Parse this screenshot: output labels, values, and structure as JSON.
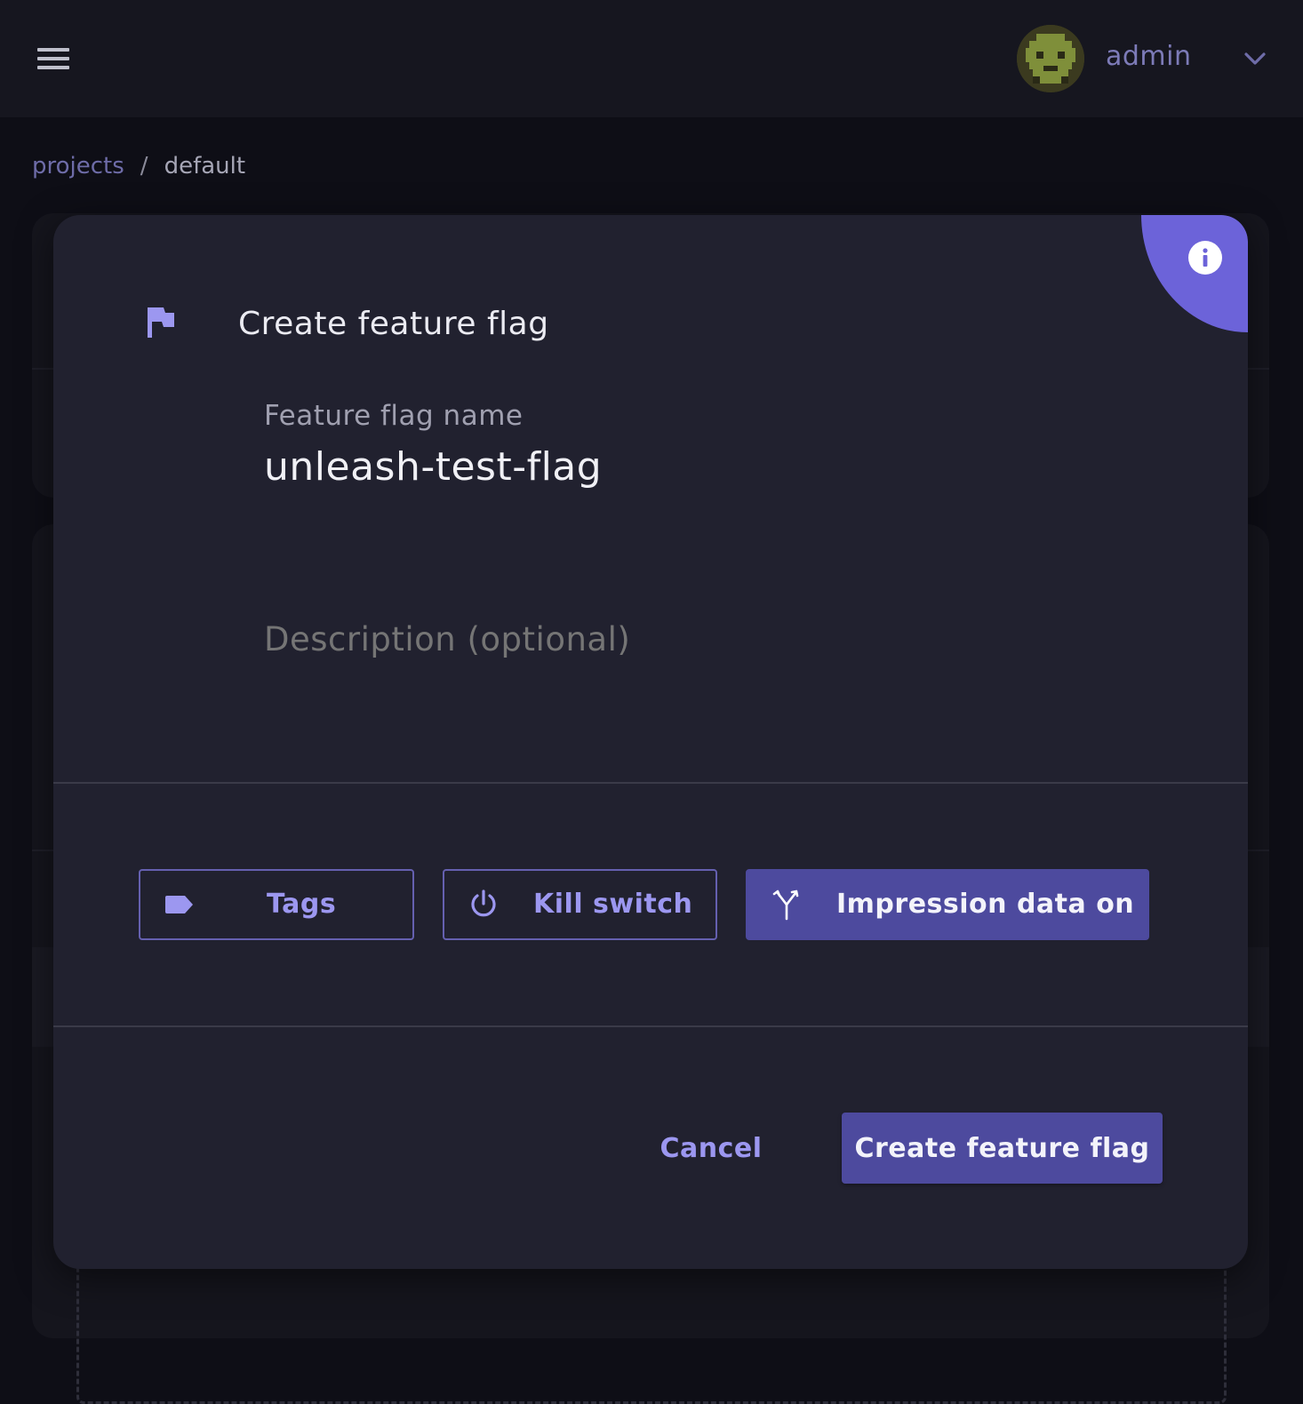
{
  "header": {
    "menu_icon": "hamburger-menu-icon",
    "user": {
      "name": "admin",
      "avatar_icon": "pixel-avatar",
      "dropdown_icon": "chevron-down-icon"
    }
  },
  "breadcrumb": {
    "parent": "projects",
    "separator": "/",
    "current": "default"
  },
  "modal": {
    "title": "Create feature flag",
    "title_icon": "flag-icon",
    "info_icon": "info-icon",
    "fields": {
      "name": {
        "label": "Feature flag name",
        "value": "unleash-test-flag"
      },
      "description": {
        "placeholder": "Description (optional)",
        "value": ""
      }
    },
    "options": [
      {
        "label": "Tags",
        "icon": "tag-icon",
        "selected": false
      },
      {
        "label": "Kill switch",
        "icon": "power-icon",
        "selected": false
      },
      {
        "label": "Impression data on",
        "icon": "merge-arrows-icon",
        "selected": true
      }
    ],
    "actions": {
      "cancel": "Cancel",
      "submit": "Create feature flag"
    }
  },
  "colors": {
    "accent": "#6c63d9",
    "primary_button": "#4d4a9e",
    "modal_bg": "#21212f",
    "page_bg": "#0e0e16"
  }
}
